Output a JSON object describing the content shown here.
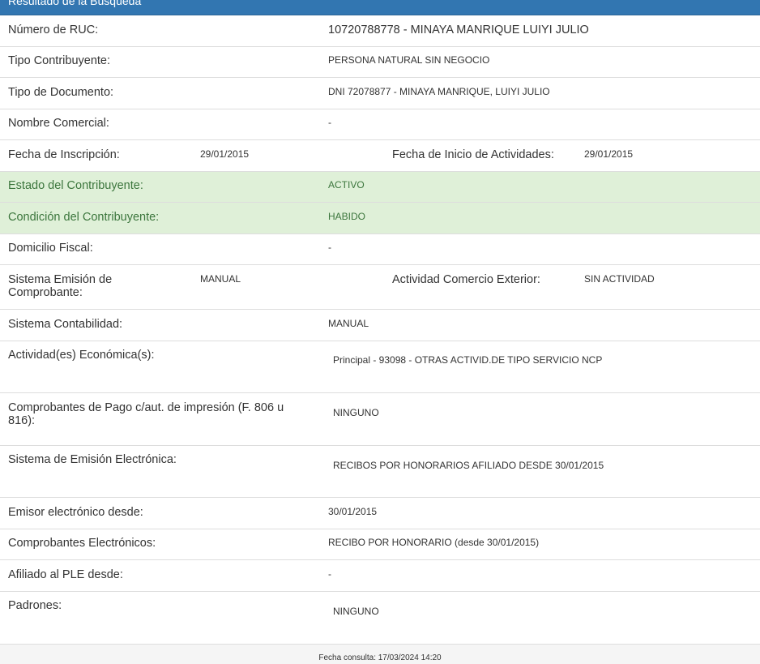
{
  "header": {
    "title": "Resultado de la Búsqueda"
  },
  "rows": {
    "ruc": {
      "label": "Número de RUC:",
      "value": "10720788778 - MINAYA MANRIQUE LUIYI JULIO"
    },
    "tipo_contribuyente": {
      "label": "Tipo Contribuyente:",
      "value": "PERSONA NATURAL SIN NEGOCIO"
    },
    "tipo_documento": {
      "label": "Tipo de Documento:",
      "value": "DNI 72078877 - MINAYA MANRIQUE, LUIYI JULIO"
    },
    "nombre_comercial": {
      "label": "Nombre Comercial:",
      "value": "-"
    },
    "fecha_inscripcion": {
      "label": "Fecha de Inscripción:",
      "value": "29/01/2015"
    },
    "fecha_inicio": {
      "label": "Fecha de Inicio de Actividades:",
      "value": "29/01/2015"
    },
    "estado": {
      "label": "Estado del Contribuyente:",
      "value": "ACTIVO"
    },
    "condicion": {
      "label": "Condición del Contribuyente:",
      "value": "HABIDO"
    },
    "domicilio": {
      "label": "Domicilio Fiscal:",
      "value": "-"
    },
    "sistema_emision": {
      "label": "Sistema Emisión de Comprobante:",
      "value": "MANUAL"
    },
    "actividad_exterior": {
      "label": "Actividad Comercio Exterior:",
      "value": "SIN ACTIVIDAD"
    },
    "sistema_contabilidad": {
      "label": "Sistema Contabilidad:",
      "value": "MANUAL"
    },
    "actividades": {
      "label": "Actividad(es) Económica(s):",
      "value": "Principal - 93098 - OTRAS ACTIVID.DE TIPO SERVICIO NCP"
    },
    "comprobantes_pago": {
      "label": "Comprobantes de Pago c/aut. de impresión (F. 806 u 816):",
      "value": "NINGUNO"
    },
    "emision_electronica": {
      "label": "Sistema de Emisión Electrónica:",
      "value": "RECIBOS POR HONORARIOS AFILIADO DESDE 30/01/2015"
    },
    "emisor_desde": {
      "label": "Emisor electrónico desde:",
      "value": "30/01/2015"
    },
    "comprobantes_electronicos": {
      "label": "Comprobantes Electrónicos:",
      "value": "RECIBO POR HONORARIO (desde 30/01/2015)"
    },
    "ple": {
      "label": "Afiliado al PLE desde:",
      "value": "-"
    },
    "padrones": {
      "label": "Padrones:",
      "value": "NINGUNO"
    }
  },
  "footer": {
    "fecha_consulta": "Fecha consulta: 17/03/2024 14:20"
  },
  "colors": {
    "heading_bg": "#3276b1",
    "success_bg": "#dff0d8",
    "success_text": "#3c763d",
    "border": "#dddddd"
  }
}
